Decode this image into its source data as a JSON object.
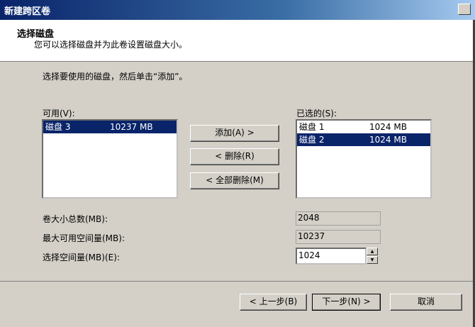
{
  "window": {
    "title": "新建跨区卷"
  },
  "header": {
    "title": "选择磁盘",
    "subtitle": "您可以选择磁盘并为此卷设置磁盘大小。"
  },
  "instruction": "选择要使用的磁盘，然后单击“添加”。",
  "available": {
    "label": "可用(V):",
    "items": [
      {
        "name": "磁盘 3",
        "size": "10237 MB",
        "selected": true
      }
    ]
  },
  "selected": {
    "label": "已选的(S):",
    "items": [
      {
        "name": "磁盘 1",
        "size": "1024 MB",
        "selected": false
      },
      {
        "name": "磁盘 2",
        "size": "1024 MB",
        "selected": true
      }
    ]
  },
  "buttons": {
    "add": "添加(A) >",
    "remove": "< 删除(R)",
    "remove_all": "< 全部删除(M)"
  },
  "totals": {
    "total_label": "卷大小总数(MB):",
    "total_value": "2048",
    "max_label": "最大可用空间量(MB):",
    "max_value": "10237",
    "choose_label": "选择空间量(MB)(E):",
    "choose_value": "1024"
  },
  "footer": {
    "back": "< 上一步(B)",
    "next": "下一步(N) >",
    "cancel": "取消"
  }
}
